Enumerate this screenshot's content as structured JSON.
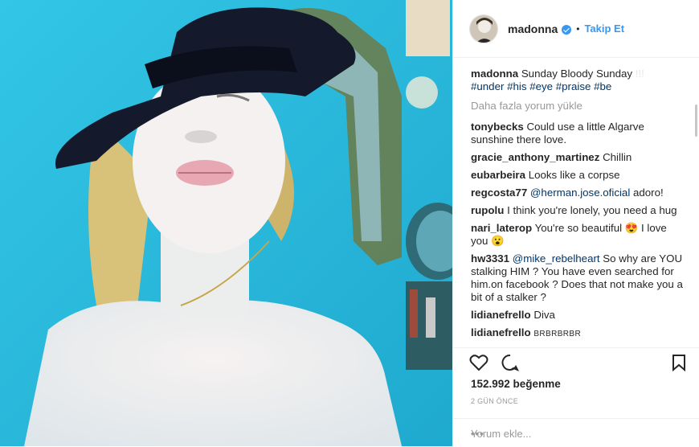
{
  "post": {
    "username": "madonna",
    "follow_label": "Takip Et",
    "separator": "•",
    "caption_user": "madonna",
    "caption_text": "Sunday Bloody Sunday",
    "caption_trailing": "!!!",
    "hashtags": [
      "#under",
      "#his",
      "#eye",
      "#praise",
      "#be"
    ],
    "load_more": "Daha fazla yorum yükle",
    "likes": "152.992 beğenme",
    "time": "2 GÜN ÖNCE",
    "add_comment_placeholder": "Yorum ekle...",
    "more_options": "•••"
  },
  "comments": [
    {
      "user": "tonybecks",
      "text": "Could use a little Algarve sunshine there love."
    },
    {
      "user": "gracie_anthony_martinez",
      "text": "Chillin"
    },
    {
      "user": "eubarbeira",
      "text": "Looks like a corpse"
    },
    {
      "user": "regcosta77",
      "mention": "@herman.jose.oficial",
      "text": " adoro!"
    },
    {
      "user": "rupolu",
      "text": "I think you're lonely, you need a hug"
    },
    {
      "user": "nari_laterop",
      "text": "You're so beautiful 😍 I love you 😮"
    },
    {
      "user": "hw3331",
      "mention": "@mike_rebelheart",
      "text": " So why are YOU stalking HIM ? You have even searched for him.on facebook ? Does that not make you a bit of a stalker ?"
    },
    {
      "user": "lidianefrello",
      "text": "Diva"
    },
    {
      "user": "lidianefrello",
      "text": "BRBRBRBR",
      "small": true
    }
  ],
  "colors": {
    "accent": "#3897f0",
    "photo_bg": "#2bc4e0"
  },
  "icons": [
    "heart-icon",
    "comment-icon",
    "bookmark-icon",
    "verified-icon"
  ]
}
